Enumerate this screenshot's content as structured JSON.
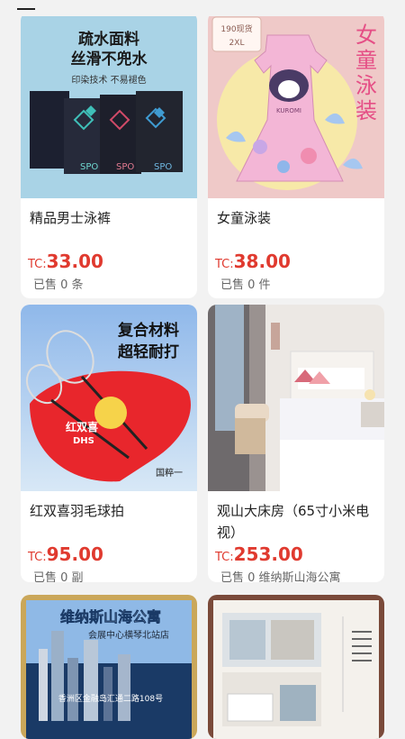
{
  "products": [
    {
      "name": "精品男士泳裤",
      "currency": "TC:",
      "price": "33.00",
      "sold": "已售 0 条",
      "image_text": [
        "疏水面料",
        "丝滑不兜水",
        "印染技术 不易褪色",
        "SPO",
        "SPO",
        "SPO"
      ]
    },
    {
      "name": "女童泳装",
      "currency": "TC:",
      "price": "38.00",
      "sold": "已售 0 件",
      "image_text": [
        "女",
        "童",
        "泳",
        "装",
        "190现货",
        "2XL",
        "KUROMI"
      ]
    },
    {
      "name": "红双喜羽毛球拍",
      "currency": "TC:",
      "price": "95.00",
      "sold": "已售 0 副",
      "image_text": [
        "复合材料",
        "超轻耐打",
        "红双喜",
        "DHS",
        "国粹一"
      ]
    },
    {
      "name": "观山大床房（65寸小米电视）",
      "currency": "TC:",
      "price": "253.00",
      "sold": "已售 0 维纳斯山海公寓",
      "image_text": []
    },
    {
      "name": "",
      "image_text": [
        "维纳斯山海公寓",
        "会展中心横琴北站店",
        "香洲区金融岛汇通二路108号"
      ]
    },
    {
      "name": "",
      "image_text": []
    }
  ],
  "colors": {
    "price": "#e03a2f",
    "page_bg": "#f2f2f2"
  }
}
